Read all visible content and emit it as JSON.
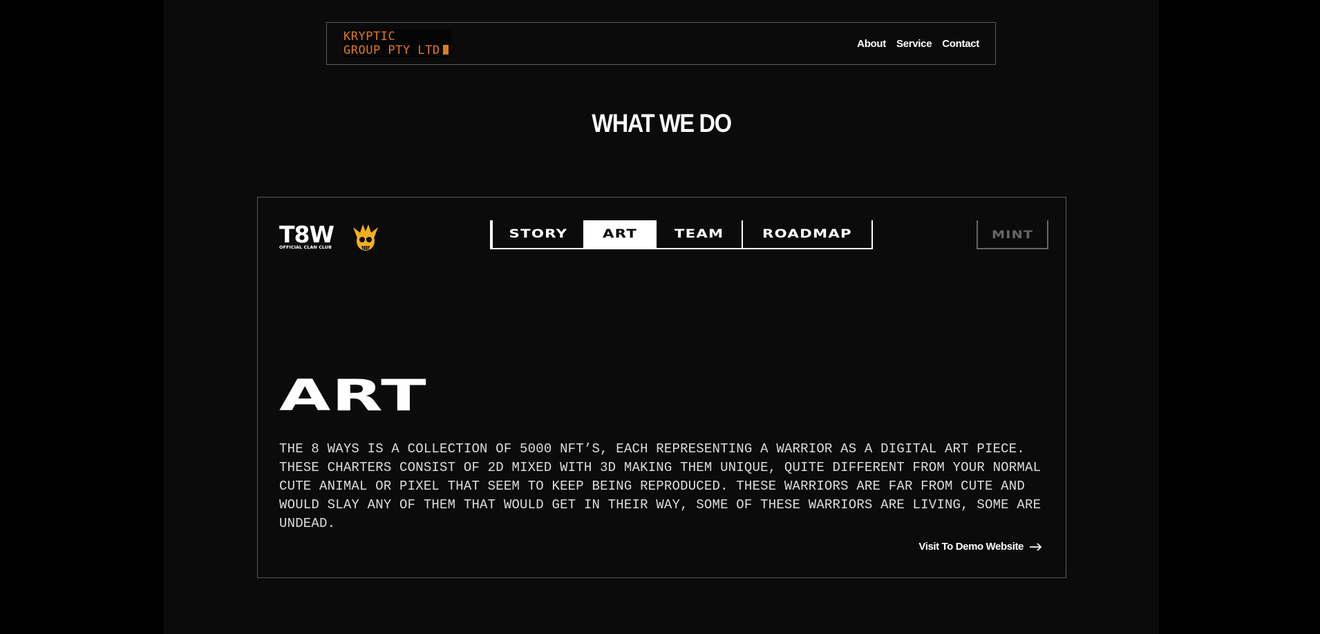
{
  "navbar": {
    "brand_line1": "KRYPTIC",
    "brand_line2": "GROUP PTY LTD",
    "links": [
      {
        "label": "About"
      },
      {
        "label": "Service"
      },
      {
        "label": "Contact"
      }
    ]
  },
  "section_title": "WHAT WE DO",
  "project": {
    "logo_text": "T8W",
    "logo_subtext": "OFFICIAL CLAN CLUB",
    "tabs": [
      {
        "label": "STORY",
        "active": false
      },
      {
        "label": "ART",
        "active": true
      },
      {
        "label": "TEAM",
        "active": false
      },
      {
        "label": "ROADMAP",
        "active": false
      }
    ],
    "mint_label": "MINT",
    "heading": "ART",
    "description": "THE 8 WAYS IS A COLLECTION OF 5000 NFT’S, EACH REPRESENTING A WARRIOR AS A DIGITAL ART PIECE. THESE CHARTERS CONSIST OF 2D MIXED WITH 3D MAKING THEM UNIQUE, QUITE DIFFERENT FROM YOUR NORMAL CUTE ANIMAL OR PIXEL THAT SEEM TO KEEP BEING REPRODUCED. THESE WARRIORS ARE FAR FROM CUTE AND WOULD SLAY ANY OF THEM THAT WOULD GET IN THEIR WAY, SOME OF THESE WARRIORS ARE LIVING, SOME ARE UNDEAD.",
    "visit_label": "Visit To Demo Website"
  },
  "colors": {
    "brand_orange": "#e07a1f",
    "logo_gold": "#f2b01e",
    "background": "#0b0b0b",
    "outer_background": "#000000"
  },
  "icons": {
    "visit": "arrow-right-icon",
    "logo_mascot": "samurai-skull-icon"
  }
}
